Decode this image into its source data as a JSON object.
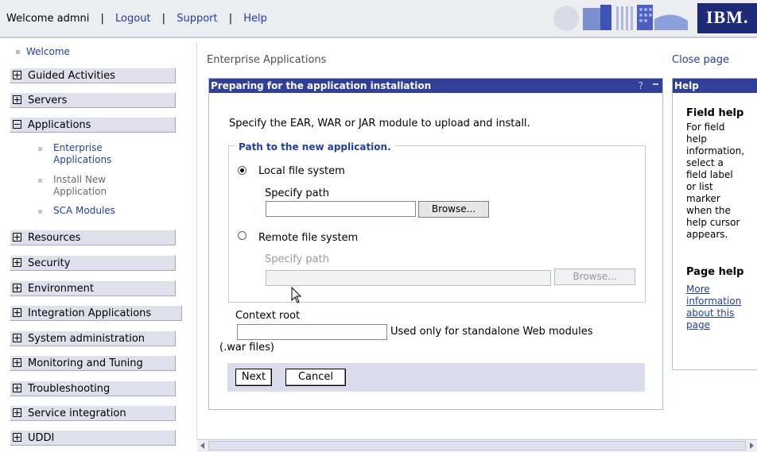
{
  "topbar": {
    "welcome": "Welcome admni",
    "logout": "Logout",
    "support": "Support",
    "help": "Help",
    "separator": "|",
    "logo": "IBM."
  },
  "nav": {
    "welcome": "Welcome",
    "sections": [
      {
        "label": "Guided Activities",
        "expanded": false
      },
      {
        "label": "Servers",
        "expanded": false
      },
      {
        "label": "Applications",
        "expanded": true
      },
      {
        "label": "Resources",
        "expanded": false
      },
      {
        "label": "Security",
        "expanded": false
      },
      {
        "label": "Environment",
        "expanded": false
      },
      {
        "label": "Integration Applications",
        "expanded": false
      },
      {
        "label": "System administration",
        "expanded": false
      },
      {
        "label": "Monitoring and Tuning",
        "expanded": false
      },
      {
        "label": "Troubleshooting",
        "expanded": false
      },
      {
        "label": "Service integration",
        "expanded": false
      },
      {
        "label": "UDDI",
        "expanded": false
      }
    ],
    "app_items": [
      {
        "line1": "Enterprise",
        "line2": "Applications"
      },
      {
        "line1": "Install New",
        "line2": "Application"
      },
      {
        "line1": "SCA Modules",
        "line2": ""
      }
    ]
  },
  "main": {
    "heading": "Enterprise Applications",
    "close_page": "Close page",
    "panel_title": "Preparing for the application installation",
    "panel_help_glyph": "?",
    "instruction": "Specify the EAR, WAR or JAR module to upload and install.",
    "legend": "Path to the new application.",
    "local_label": "Local file system",
    "local_selected": true,
    "specify_path": "Specify path",
    "local_path_value": "",
    "browse": "Browse...",
    "remote_label": "Remote file system",
    "remote_specify_path": "Specify path",
    "remote_path_value": "",
    "remote_browse": "Browse...",
    "context_root_label": "Context root",
    "context_root_value": "",
    "context_note": "Used only for standalone Web modules",
    "context_note2": "(.war files)",
    "next": "Next",
    "cancel": "Cancel"
  },
  "help": {
    "title": "Help",
    "field_help_heading": "Field help",
    "field_help_lines": [
      "For field",
      "help",
      "information,",
      "select a",
      "field label",
      "or list",
      "marker",
      "when the",
      "help cursor",
      "appears."
    ],
    "page_help_heading": "Page help",
    "more_info_lines": [
      "More",
      "information",
      "about this",
      "page"
    ]
  },
  "colors": {
    "title_bar": "#303f98",
    "link": "#1f3fa8",
    "nav_section_bg": "#e0e0ec",
    "button_bar": "#dadcec"
  }
}
